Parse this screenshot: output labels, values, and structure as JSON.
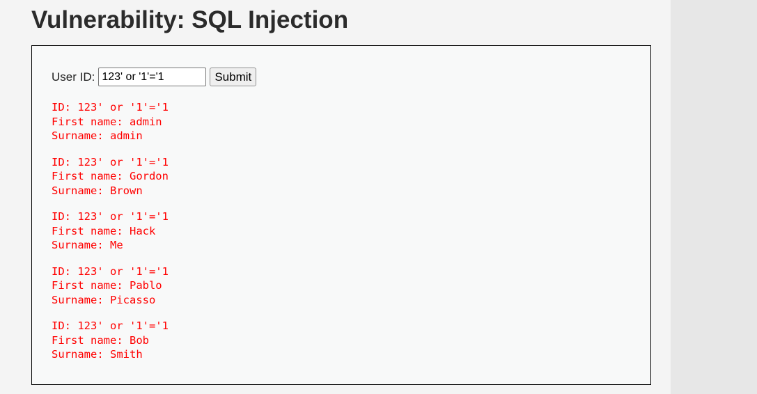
{
  "page": {
    "title": "Vulnerability: SQL Injection"
  },
  "form": {
    "user_id_label": "User ID:",
    "user_id_value": "123' or '1'='1",
    "submit_label": "Submit"
  },
  "results": [
    {
      "id_line": "ID: 123' or '1'='1",
      "first_line": "First name: admin",
      "surname_line": "Surname: admin"
    },
    {
      "id_line": "ID: 123' or '1'='1",
      "first_line": "First name: Gordon",
      "surname_line": "Surname: Brown"
    },
    {
      "id_line": "ID: 123' or '1'='1",
      "first_line": "First name: Hack",
      "surname_line": "Surname: Me"
    },
    {
      "id_line": "ID: 123' or '1'='1",
      "first_line": "First name: Pablo",
      "surname_line": "Surname: Picasso"
    },
    {
      "id_line": "ID: 123' or '1'='1",
      "first_line": "First name: Bob",
      "surname_line": "Surname: Smith"
    }
  ],
  "colors": {
    "result_text": "#ff0000",
    "background": "#f4f4f4",
    "right_panel": "#e7e7e7"
  }
}
